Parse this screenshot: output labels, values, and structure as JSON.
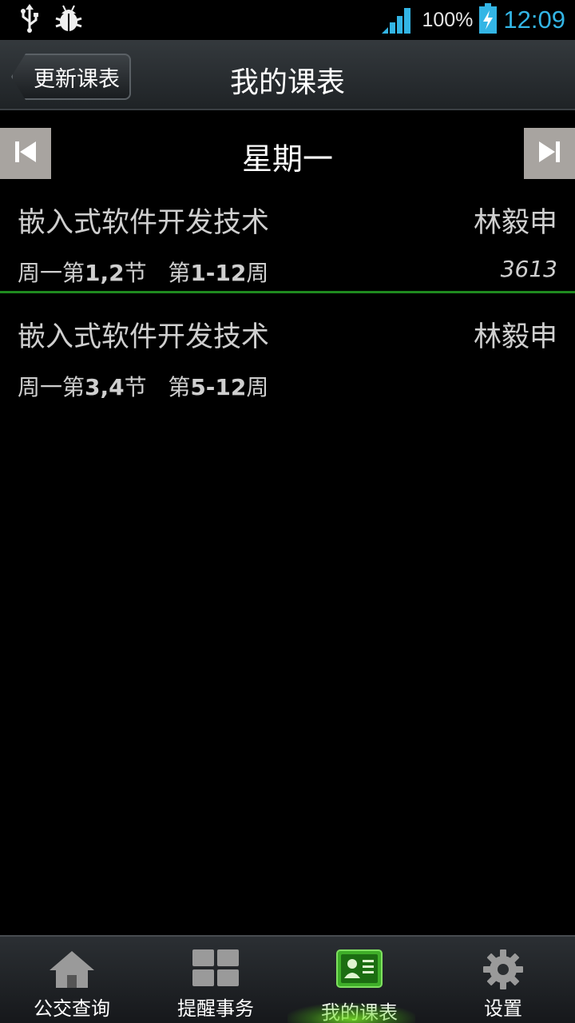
{
  "status_bar": {
    "battery_percent": "100%",
    "time": "12:09",
    "icons": [
      "usb-icon",
      "bug-icon",
      "signal-icon",
      "battery-charging-icon"
    ]
  },
  "header": {
    "back_label": "更新课表",
    "title": "我的课表"
  },
  "day_nav": {
    "day": "星期一",
    "prev_icon": "skip-previous-icon",
    "next_icon": "skip-next-icon"
  },
  "courses": [
    {
      "name": "嵌入式软件开发技术",
      "teacher": "林毅申",
      "time_prefix": "周一第",
      "sections": "1,2",
      "time_mid": "节   第",
      "weeks": "1-12",
      "time_suffix": "周",
      "room": "3613"
    },
    {
      "name": "嵌入式软件开发技术",
      "teacher": "林毅申",
      "time_prefix": "周一第",
      "sections": "3,4",
      "time_mid": "节   第",
      "weeks": "5-12",
      "time_suffix": "周",
      "room": ""
    }
  ],
  "tabs": [
    {
      "label": "公交查询",
      "icon": "home-icon"
    },
    {
      "label": "提醒事务",
      "icon": "grid-icon"
    },
    {
      "label": "我的课表",
      "icon": "contact-card-icon",
      "active": true
    },
    {
      "label": "设置",
      "icon": "gear-icon"
    }
  ],
  "colors": {
    "accent_clock": "#33b5e5",
    "divider_green": "#1f8a1f",
    "active_tab_green": "#3fae29"
  }
}
